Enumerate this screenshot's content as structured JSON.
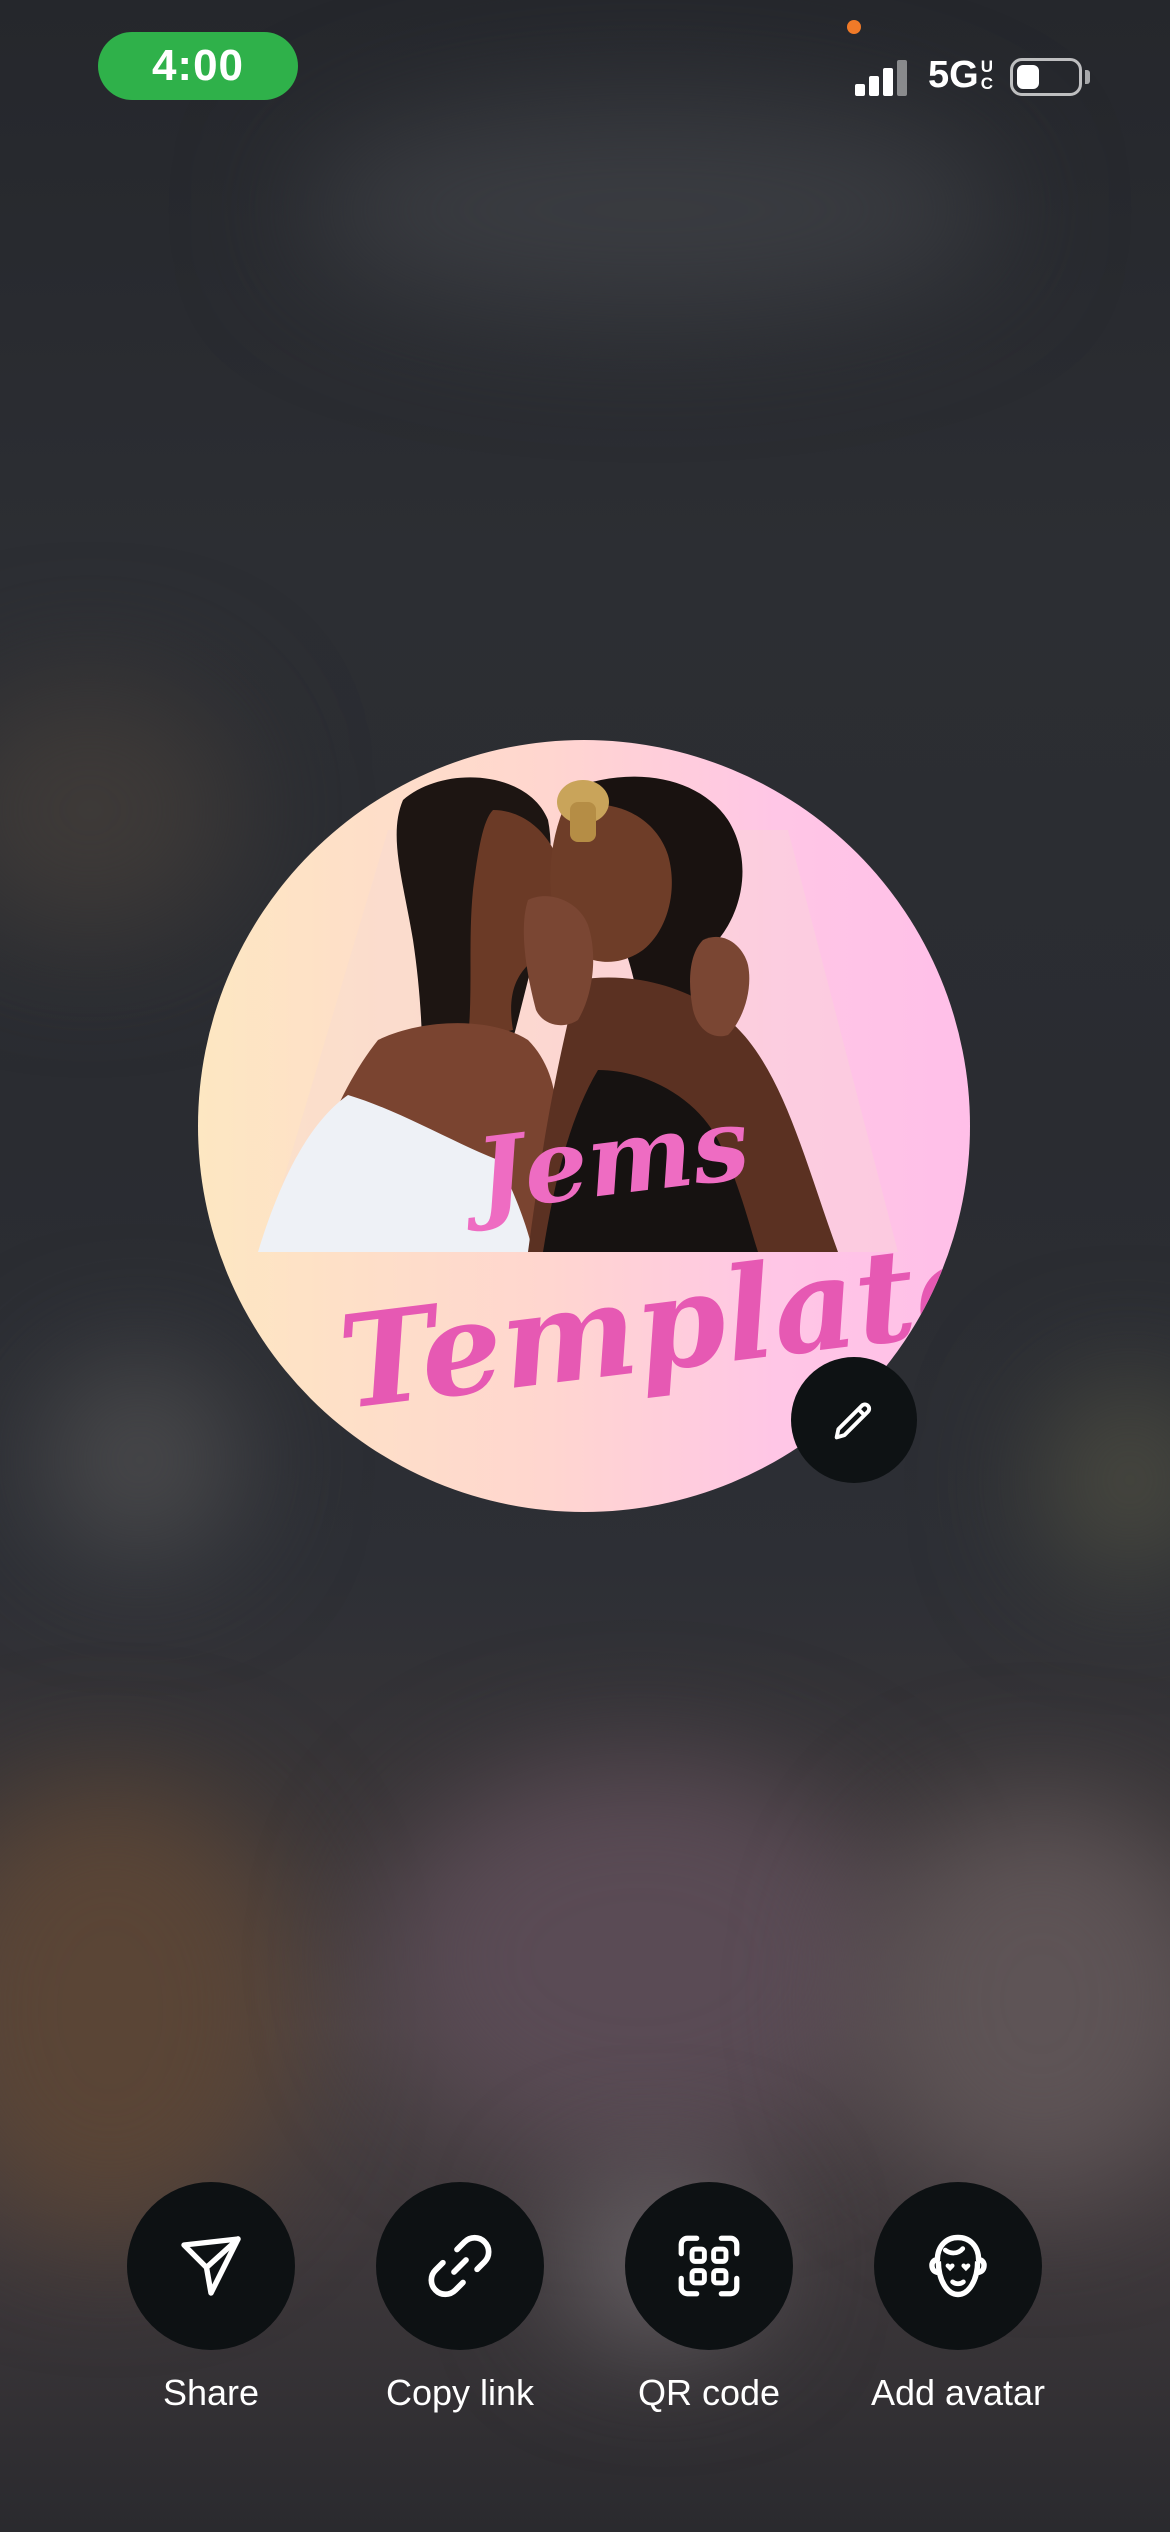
{
  "status_bar": {
    "time": "4:00",
    "network_main": "5G",
    "network_sup": "U",
    "network_sub": "C"
  },
  "colors": {
    "time_pill": "#2fb14a",
    "privacy_dot": "#f07a28",
    "button_bg": "#0d1113",
    "brand_pink": "#e95fb8"
  },
  "avatar": {
    "brand_line_1": "Jems",
    "brand_line_2": "Templates"
  },
  "edit": {
    "icon": "pencil-icon"
  },
  "actions": [
    {
      "label": "Share",
      "icon": "send-icon"
    },
    {
      "label": "Copy link",
      "icon": "link-icon"
    },
    {
      "label": "QR code",
      "icon": "qr-code-icon"
    },
    {
      "label": "Add avatar",
      "icon": "avatar-face-icon"
    }
  ]
}
